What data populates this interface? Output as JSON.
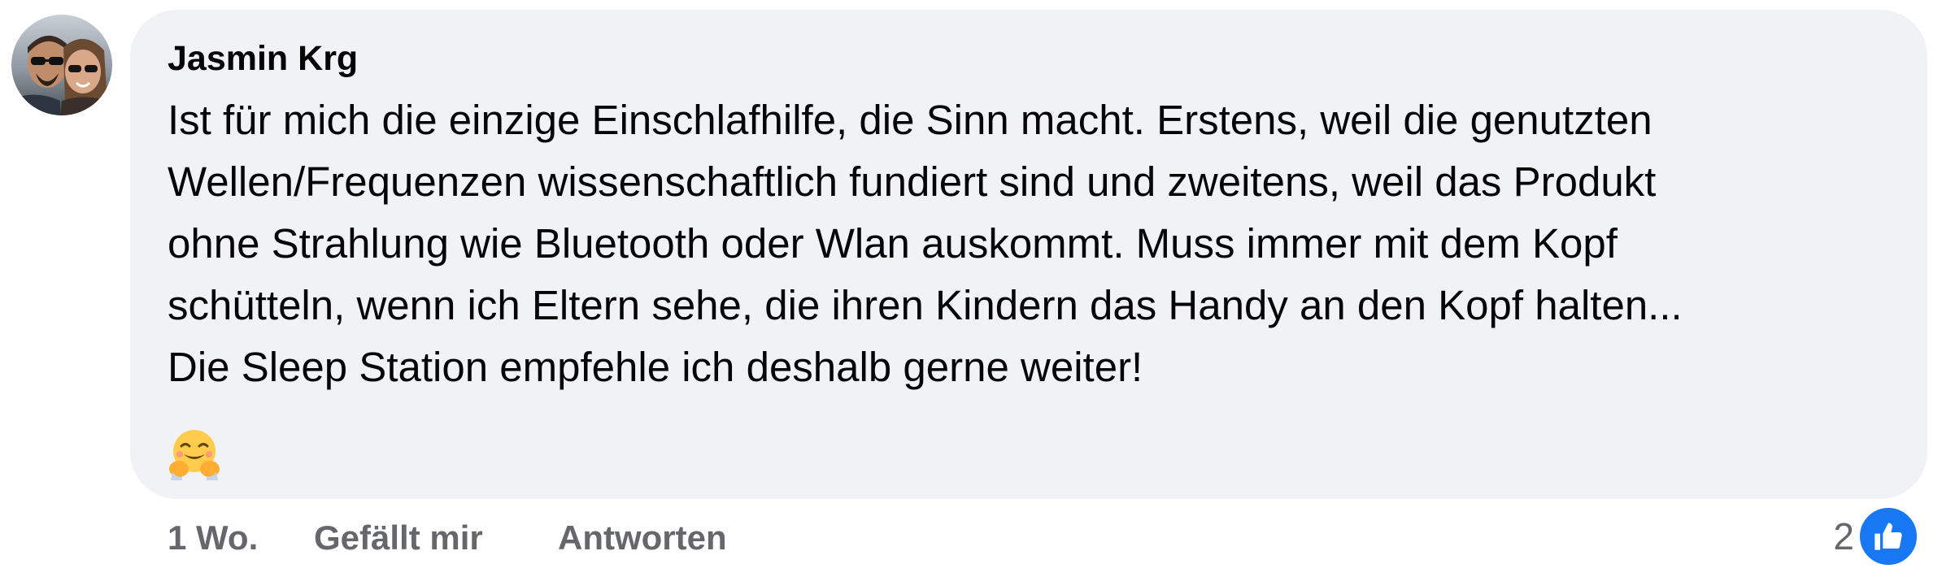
{
  "comment": {
    "author": "Jasmin Krg",
    "text_lines": [
      "Ist für mich die einzige Einschlafhilfe, die Sinn macht. Erstens, weil die genutzten",
      "Wellen/Frequenzen wissenschaftlich fundiert sind und zweitens, weil das Produkt",
      "ohne Strahlung wie Bluetooth oder Wlan auskommt. Muss immer mit dem Kopf",
      "schütteln, wenn ich Eltern sehe, die ihren Kindern das Handy an den Kopf halten...",
      "Die Sleep Station empfehle ich deshalb gerne weiter!"
    ],
    "emoji": "🤗",
    "emoji_icon": "hugging-face-icon"
  },
  "actions": {
    "time": "1 Wo.",
    "like_label": "Gefällt mir",
    "reply_label": "Antworten"
  },
  "reactions": {
    "count": "2",
    "icon": "thumbs-up-icon",
    "color": "#1877f2"
  },
  "colors": {
    "bubble_bg": "#f0f2f5",
    "text": "#050505",
    "secondary_text": "#65676b",
    "accent": "#1877f2"
  }
}
